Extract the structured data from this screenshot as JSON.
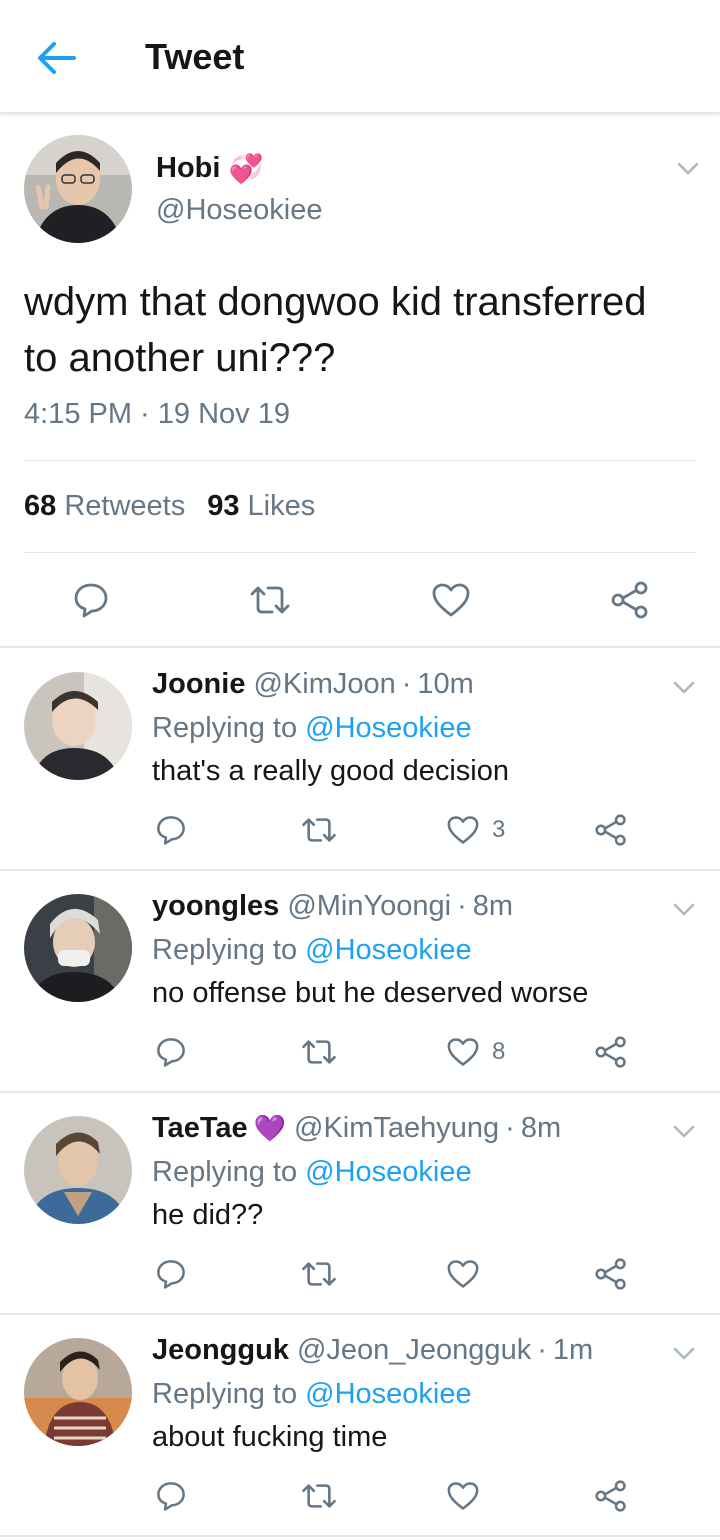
{
  "header": {
    "title": "Tweet",
    "back_icon": "arrow-left-icon",
    "accent": "#1da1f2"
  },
  "main_tweet": {
    "name": "Hobi",
    "name_emoji": "💞",
    "handle": "@Hoseokiee",
    "text": "wdym that dongwoo kid transferred to another uni???",
    "time": "4:15 PM · 19 Nov 19",
    "retweets_count": "68",
    "retweets_label": "Retweets",
    "likes_count": "93",
    "likes_label": "Likes"
  },
  "replies": [
    {
      "name": "Joonie",
      "emoji": "",
      "handle": "@KimJoon",
      "time": "10m",
      "replying_label": "Replying to",
      "replying_to": "@Hoseokiee",
      "text": "that's a really good decision",
      "likes": "3"
    },
    {
      "name": "yoongles",
      "emoji": "",
      "handle": "@MinYoongi",
      "time": "8m",
      "replying_label": "Replying to",
      "replying_to": "@Hoseokiee",
      "text": "no offense but he deserved worse",
      "likes": "8"
    },
    {
      "name": "TaeTae",
      "emoji": "💜",
      "handle": "@KimTaehyung",
      "time": "8m",
      "replying_label": "Replying to",
      "replying_to": "@Hoseokiee",
      "text": "he did??",
      "likes": ""
    },
    {
      "name": "Jeongguk",
      "emoji": "",
      "handle": "@Jeon_Jeongguk",
      "time": "1m",
      "replying_label": "Replying to",
      "replying_to": "@Hoseokiee",
      "text": "about fucking time",
      "likes": ""
    }
  ],
  "icons": [
    "reply-icon",
    "retweet-icon",
    "like-icon",
    "share-icon",
    "chevron-down-icon"
  ],
  "colors": {
    "text": "#14171a",
    "secondary": "#657786",
    "link": "#1da1f2",
    "divider": "#e1e8ed"
  }
}
